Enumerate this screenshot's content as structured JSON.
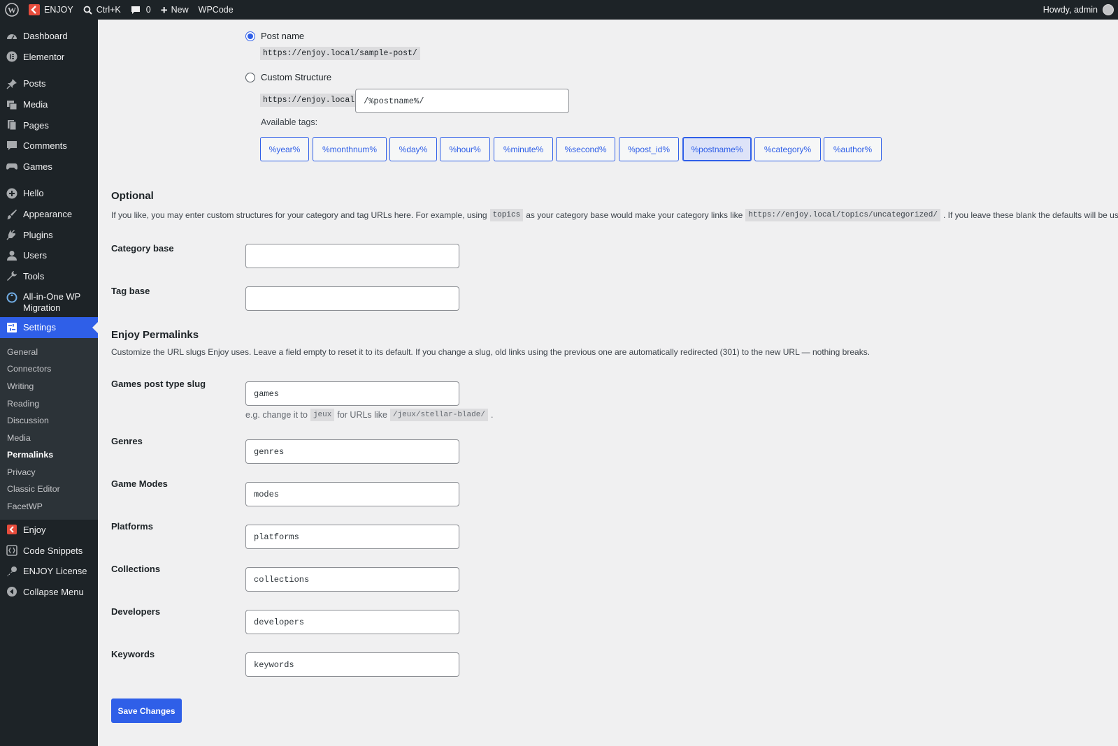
{
  "adminbar": {
    "site_name": "ENJOY",
    "search_shortcut": "Ctrl+K",
    "comments_count": "0",
    "new_label": "New",
    "wpcode_label": "WPCode",
    "howdy": "Howdy, admin"
  },
  "sidebar": {
    "items_top": [
      {
        "label": "Dashboard",
        "icon": "dashboard-icon"
      },
      {
        "label": "Elementor",
        "icon": "elementor-icon"
      }
    ],
    "items_content": [
      {
        "label": "Posts",
        "icon": "pin-icon"
      },
      {
        "label": "Media",
        "icon": "media-icon"
      },
      {
        "label": "Pages",
        "icon": "pages-icon"
      },
      {
        "label": "Comments",
        "icon": "comments-icon"
      },
      {
        "label": "Games",
        "icon": "gamepad-icon"
      }
    ],
    "items_admin": [
      {
        "label": "Hello",
        "icon": "plus-circle-icon"
      },
      {
        "label": "Appearance",
        "icon": "brush-icon"
      },
      {
        "label": "Plugins",
        "icon": "plug-icon"
      },
      {
        "label": "Users",
        "icon": "user-icon"
      },
      {
        "label": "Tools",
        "icon": "wrench-icon"
      },
      {
        "label": "All-in-One WP Migration",
        "icon": "migration-icon"
      }
    ],
    "settings_label": "Settings",
    "submenu": [
      "General",
      "Connectors",
      "Writing",
      "Reading",
      "Discussion",
      "Media",
      "Permalinks",
      "Privacy",
      "Classic Editor",
      "FacetWP"
    ],
    "active_submenu": "Permalinks",
    "items_bottom": [
      {
        "label": "Enjoy",
        "icon": "enjoy-icon"
      },
      {
        "label": "Code Snippets",
        "icon": "snippets-icon"
      },
      {
        "label": "ENJOY License",
        "icon": "key-icon"
      },
      {
        "label": "Collapse Menu",
        "icon": "collapse-icon"
      }
    ]
  },
  "permalink_structure": {
    "post_name_label": "Post name",
    "post_name_example": "https://enjoy.local/sample-post/",
    "custom_label": "Custom Structure",
    "custom_prefix": "https://enjoy.local",
    "custom_value": "/%postname%/",
    "available_tags_label": "Available tags:",
    "tags": [
      "%year%",
      "%monthnum%",
      "%day%",
      "%hour%",
      "%minute%",
      "%second%",
      "%post_id%",
      "%postname%",
      "%category%",
      "%author%"
    ],
    "active_tag": "%postname%"
  },
  "optional": {
    "title": "Optional",
    "desc_1": "If you like, you may enter custom structures for your category and tag URLs here. For example, using",
    "desc_code_1": "topics",
    "desc_2": "as your category base would make your category links like",
    "desc_code_2": "https://enjoy.local/topics/uncategorized/",
    "desc_3": ". If you leave these blank the defaults will be used.",
    "category_base_label": "Category base",
    "category_base_value": "",
    "tag_base_label": "Tag base",
    "tag_base_value": ""
  },
  "enjoy_permalinks": {
    "title": "Enjoy Permalinks",
    "desc": "Customize the URL slugs Enjoy uses. Leave a field empty to reset it to its default. If you change a slug, old links using the previous one are automatically redirected (301) to the new URL — nothing breaks.",
    "games_label": "Games post type slug",
    "games_value": "games",
    "hint_1": "e.g. change it to",
    "hint_code_1": "jeux",
    "hint_2": "for URLs like",
    "hint_code_2": "/jeux/stellar-blade/",
    "hint_3": ".",
    "genres_label": "Genres",
    "genres_value": "genres",
    "modes_label": "Game Modes",
    "modes_value": "modes",
    "platforms_label": "Platforms",
    "platforms_value": "platforms",
    "collections_label": "Collections",
    "collections_value": "collections",
    "developers_label": "Developers",
    "developers_value": "developers",
    "keywords_label": "Keywords",
    "keywords_value": "keywords"
  },
  "save_label": "Save Changes",
  "colors": {
    "accent": "#2f5fe8",
    "sidebar_bg": "#1d2327",
    "page_bg": "#f0f0f1"
  }
}
